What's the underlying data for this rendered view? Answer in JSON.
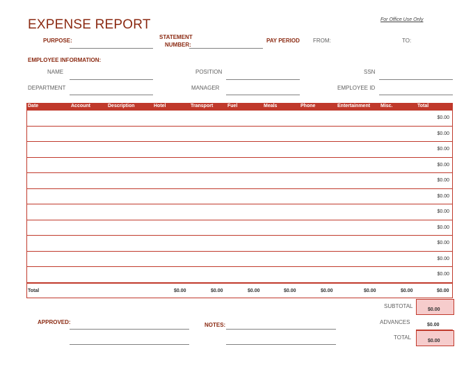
{
  "header": {
    "title": "EXPENSE REPORT",
    "office_use": "For Office Use Only",
    "purpose_label": "PURPOSE:",
    "statement_label_1": "STATEMENT",
    "statement_label_2": "NUMBER:",
    "pay_period_label": "PAY PERIOD",
    "from_label": "FROM:",
    "to_label": "TO:"
  },
  "employee": {
    "section_label": "EMPLOYEE INFORMATION:",
    "name_label": "NAME",
    "position_label": "POSITION",
    "ssn_label": "SSN",
    "department_label": "DEPARTMENT",
    "manager_label": "MANAGER",
    "employee_id_label": "EMPLOYEE ID"
  },
  "table": {
    "columns": [
      "Date",
      "Account",
      "Description",
      "Hotel",
      "Transport",
      "Fuel",
      "Meals",
      "Phone",
      "Entertainment",
      "Misc.",
      "Total"
    ],
    "row_totals": [
      "$0.00",
      "$0.00",
      "$0.00",
      "$0.00",
      "$0.00",
      "$0.00",
      "$0.00",
      "$0.00",
      "$0.00",
      "$0.00",
      "$0.00"
    ],
    "total_label": "Total",
    "column_totals": [
      "$0.00",
      "$0.00",
      "$0.00",
      "$0.00",
      "$0.00",
      "$0.00",
      "$0.00",
      "$0.00"
    ]
  },
  "summary": {
    "subtotal_label": "SUBTOTAL",
    "subtotal_value": "$0.00",
    "advances_label": "ADVANCES",
    "advances_value": "$0.00",
    "total_label": "TOTAL",
    "total_value": "$0.00",
    "highlight_color": "#f6cccc"
  },
  "footer": {
    "approved_label": "APPROVED:",
    "notes_label": "NOTES:"
  },
  "colors": {
    "accent": "#c0392b",
    "title": "#8b2a12"
  }
}
